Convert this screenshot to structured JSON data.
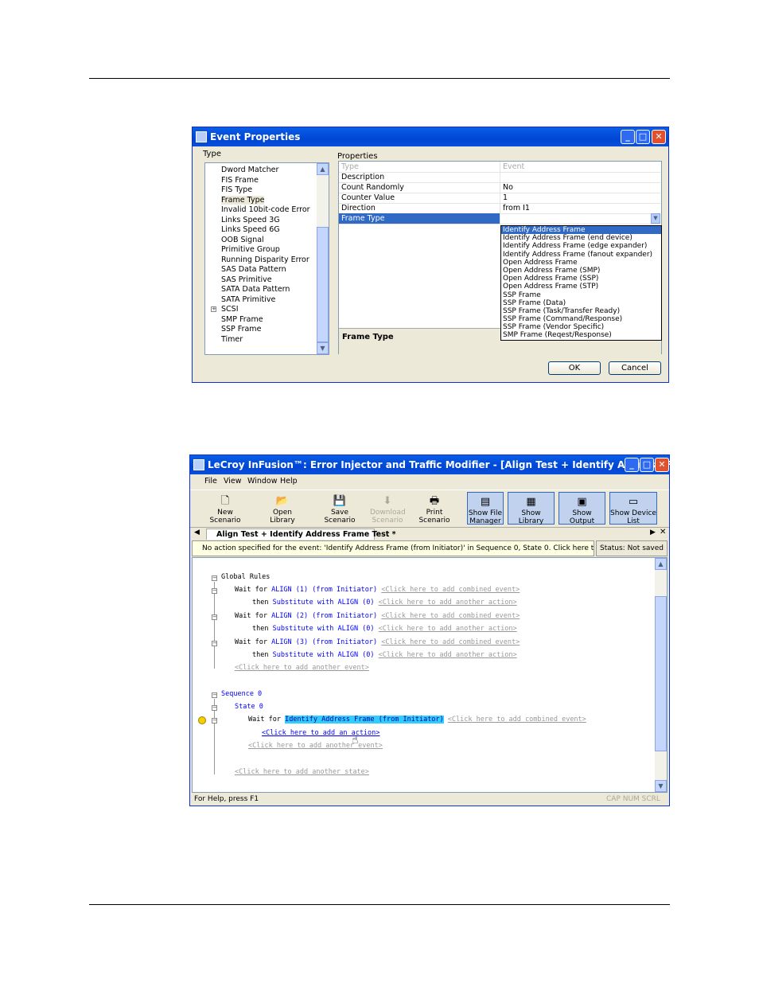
{
  "dialog": {
    "title": "Event Properties",
    "type_label": "Type",
    "properties_label": "Properties",
    "tree_items": [
      "Dword Matcher",
      "FIS Frame",
      "FIS Type",
      "Frame Type",
      "Invalid 10bit-code Error",
      "Links Speed 3G",
      "Links Speed 6G",
      "OOB Signal",
      "Primitive Group",
      "Running Disparity Error",
      "SAS Data Pattern",
      "SAS Primitive",
      "SATA Data Pattern",
      "SATA Primitive",
      "SCSI",
      "SMP Frame",
      "SSP Frame",
      "Timer"
    ],
    "selected_tree_item": "Frame Type",
    "properties": [
      {
        "key": "Type",
        "value": "Event"
      },
      {
        "key": "Description",
        "value": ""
      },
      {
        "key": "Count Randomly",
        "value": "No"
      },
      {
        "key": "Counter Value",
        "value": "1"
      },
      {
        "key": "Direction",
        "value": "from I1"
      },
      {
        "key": "Frame Type",
        "value": ""
      }
    ],
    "dropdown_options": [
      "Identify Address Frame",
      "Identify Address Frame (end device)",
      "Identify Address Frame (edge expander)",
      "Identify Address Frame (fanout expander)",
      "Open Address Frame",
      "Open Address Frame (SMP)",
      "Open Address Frame (SSP)",
      "Open Address Frame (STP)",
      "SSP Frame",
      "SSP Frame (Data)",
      "SSP Frame (Task/Transfer Ready)",
      "SSP Frame (Command/Response)",
      "SSP Frame (Vendor Specific)",
      "SMP Frame (Reqest/Response)"
    ],
    "description_title": "Frame Type",
    "ok_label": "OK",
    "cancel_label": "Cancel"
  },
  "app": {
    "title": "LeCroy InFusion™: Error Injector and Traffic Modifier - [Align Test + Identify Address Frame Test *]",
    "menu": [
      "File",
      "View",
      "Window",
      "Help"
    ],
    "toolbar": [
      {
        "label": "New Scenario",
        "icon": "new-document-icon"
      },
      {
        "label": "Open Library",
        "icon": "open-folder-icon"
      },
      {
        "label": "Save Scenario",
        "icon": "save-disk-icon"
      },
      {
        "label": "Download Scenario",
        "icon": "download-icon"
      },
      {
        "label": "Print Scenario",
        "icon": "printer-icon"
      },
      {
        "label": "Show File Manager",
        "icon": "file-manager-icon"
      },
      {
        "label": "Show Library",
        "icon": "library-icon"
      },
      {
        "label": "Show Output",
        "icon": "output-icon"
      },
      {
        "label": "Show Device List",
        "icon": "device-list-icon"
      }
    ],
    "tab_label": "Align Test + Identify Address Frame Test *",
    "warning": "No action specified for the event: 'Identify Address Frame (from Initiator)' in Sequence 0, State 0.  Click here to jump to the pr...",
    "status": "Status: Not saved",
    "code": {
      "global_rules": "Global Rules",
      "wait_for": "Wait for",
      "then": "then",
      "substitute": "Substitute with ALIGN (0)",
      "align1": "ALIGN (1) (from Initiator)",
      "align2": "ALIGN (2) (from Initiator)",
      "align3": "ALIGN (3) (from Initiator)",
      "add_combined": "<Click here to add combined event>",
      "add_another_action": "<Click here to add another action>",
      "add_another_event": "<Click here to add another event>",
      "sequence": "Sequence 0",
      "state": "State 0",
      "identify_event": "Identify Address Frame (from Initiator)",
      "add_an_action": "<Click here to add an action>",
      "add_another_state": "<Click here to add another state>"
    },
    "statusbar_help": "For Help, press F1",
    "statusbar_indicators": "CAP  NUM  SCRL"
  }
}
